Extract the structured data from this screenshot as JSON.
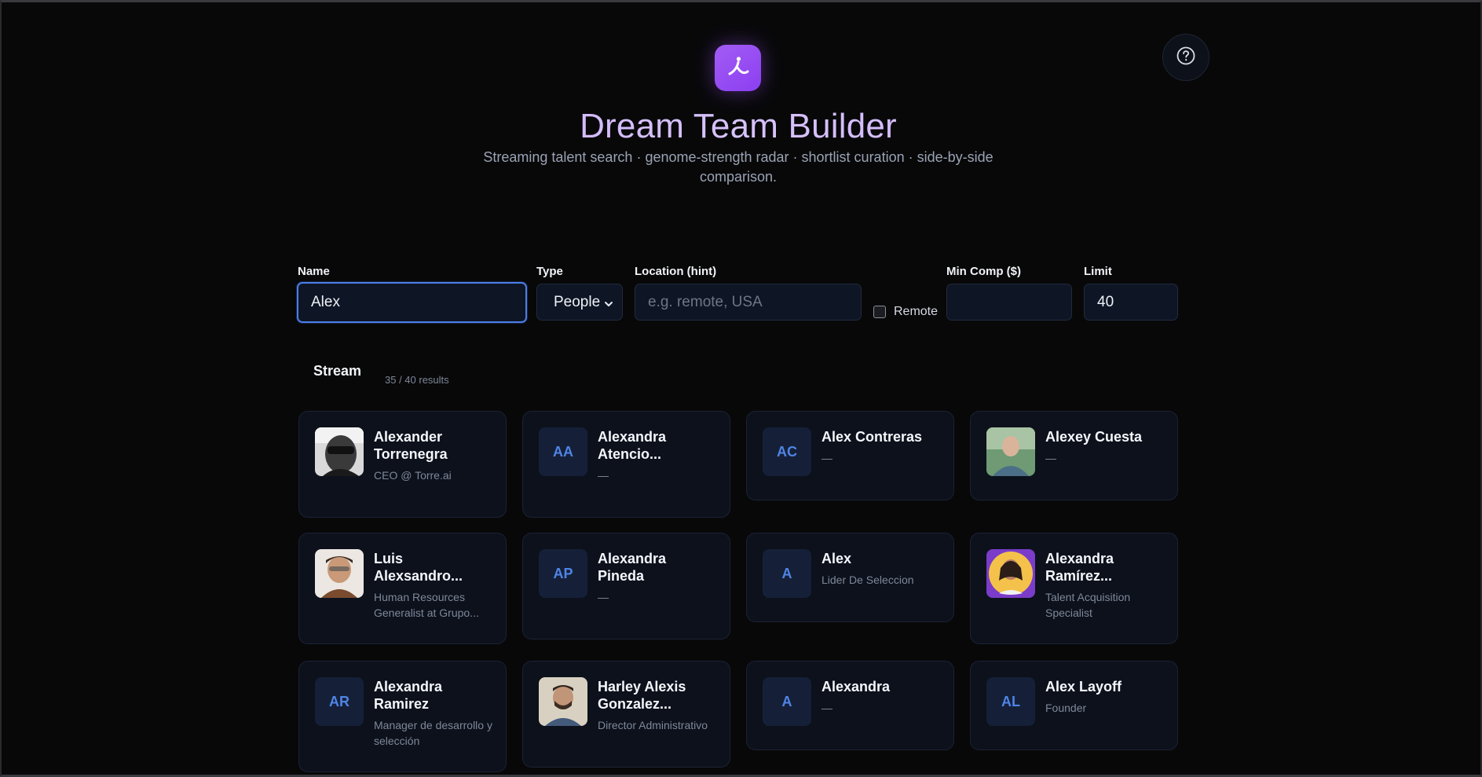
{
  "header": {
    "title": "Dream Team Builder",
    "subtitle": "Streaming talent search · genome-strength radar · shortlist curation · side-by-side comparison.",
    "logo_icon": "logo-icon",
    "help_icon": "help-circle-icon"
  },
  "filters": {
    "name": {
      "label": "Name",
      "value": "Alex"
    },
    "type": {
      "label": "Type",
      "value": "People"
    },
    "location": {
      "label": "Location (hint)",
      "placeholder": "e.g. remote, USA"
    },
    "remote": {
      "label": "Remote",
      "checked": false
    },
    "min_comp": {
      "label": "Min Comp ($)",
      "value": ""
    },
    "limit": {
      "label": "Limit",
      "value": "40"
    }
  },
  "stream": {
    "title": "Stream",
    "count": "35 / 40 results",
    "cards": [
      {
        "name": "Alexander Torrenegra",
        "role": "CEO @ Torre.ai",
        "initials": "",
        "photo": true
      },
      {
        "name": "Alexandra Atencio...",
        "role": "—",
        "initials": "AA",
        "photo": false
      },
      {
        "name": "Alex Contreras",
        "role": "—",
        "initials": "AC",
        "photo": false
      },
      {
        "name": "Alexey Cuesta",
        "role": "—",
        "initials": "",
        "photo": true
      },
      {
        "name": "Luis Alexsandro...",
        "role": "Human Resources Generalist at Grupo...",
        "initials": "",
        "photo": true
      },
      {
        "name": "Alexandra Pineda",
        "role": "—",
        "initials": "AP",
        "photo": false
      },
      {
        "name": "Alex",
        "role": "Lider De Seleccion",
        "initials": "A",
        "photo": false
      },
      {
        "name": "Alexandra Ramírez...",
        "role": "Talent Acquisition Specialist",
        "initials": "",
        "photo": true
      },
      {
        "name": "Alexandra Ramirez",
        "role": "Manager de desarrollo y selección",
        "initials": "AR",
        "photo": false
      },
      {
        "name": "Harley Alexis Gonzalez...",
        "role": "Director Administrativo",
        "initials": "",
        "photo": true
      },
      {
        "name": "Alexandra",
        "role": "—",
        "initials": "A",
        "photo": false
      },
      {
        "name": "Alex Layoff",
        "role": "Founder",
        "initials": "AL",
        "photo": false
      }
    ]
  },
  "colors": {
    "background": "#080809",
    "accent": "#8b3ff0",
    "focus": "#4a7de8",
    "card": "#0c111c"
  }
}
